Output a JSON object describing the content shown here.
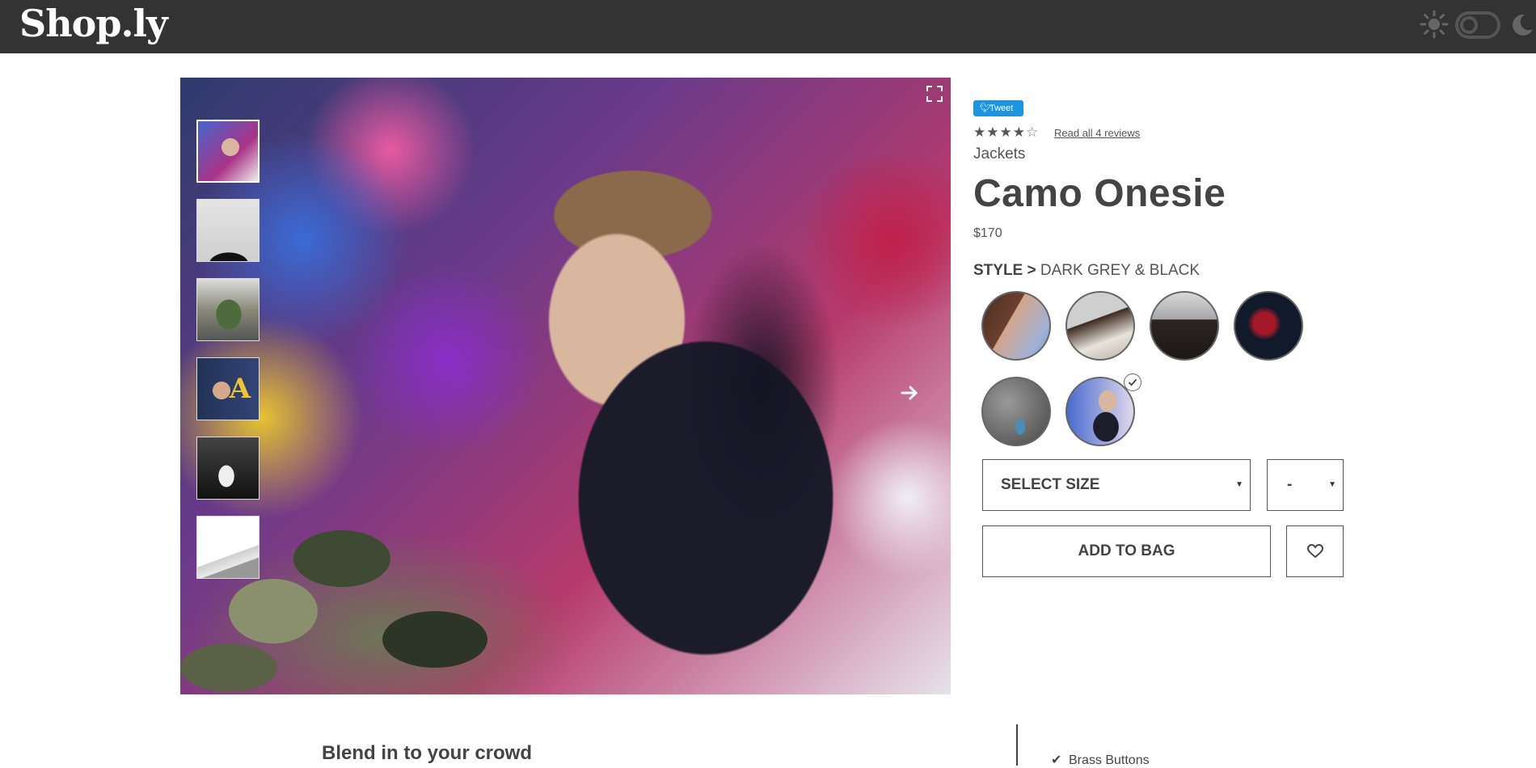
{
  "header": {
    "logo": "Shop.ly",
    "theme": {
      "sun_icon": "sun-icon",
      "moon_icon": "moon-icon",
      "mode": "light"
    }
  },
  "gallery": {
    "thumbnails": [
      "thumbnail-1",
      "thumbnail-2",
      "thumbnail-3",
      "thumbnail-4",
      "thumbnail-5",
      "thumbnail-6"
    ],
    "active_index": 0,
    "thumb4_letter": "A"
  },
  "product": {
    "tweet_label": "Tweet",
    "rating": 4,
    "rating_max": 5,
    "reviews_link": "Read all 4 reviews",
    "category": "Jackets",
    "title": "Camo Onesie",
    "price": "$170",
    "style_label": "STYLE",
    "style_separator": ">",
    "style_value": "DARK GREY & BLACK",
    "swatch_count": 6,
    "selected_swatch": 6,
    "size_select": "SELECT SIZE",
    "qty_select": "-",
    "add_to_bag": "ADD TO BAG"
  },
  "details": {
    "heading": "Blend in to your crowd",
    "features": [
      "Brass Buttons"
    ]
  },
  "colors": {
    "header_bg": "#333333",
    "text": "#444444",
    "tweet_blue": "#1b95e0"
  }
}
